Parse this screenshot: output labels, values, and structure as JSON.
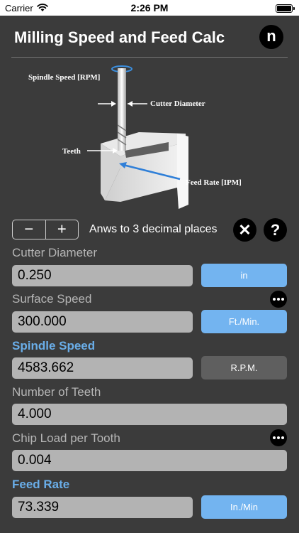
{
  "status_bar": {
    "carrier": "Carrier",
    "time": "2:26 PM",
    "wifi_icon": "wifi-icon",
    "battery_icon": "battery-icon"
  },
  "header": {
    "title": "Milling Speed and Feed Calc",
    "logo_letter": "n"
  },
  "diagram": {
    "spindle_label": "Spindle Speed [RPM]",
    "cutter_label": "Cutter Diameter",
    "teeth_label": "Teeth",
    "feed_label": "Feed Rate [IPM]"
  },
  "controls": {
    "decrement_label": "−",
    "increment_label": "+",
    "decimals_text": "Anws to 3 decimal places",
    "clear_symbol": "✕",
    "help_symbol": "?"
  },
  "fields": {
    "cutter_diameter": {
      "label": "Cutter Diameter",
      "value": "0.250",
      "unit": "in"
    },
    "surface_speed": {
      "label": "Surface Speed",
      "value": "300.000",
      "unit": "Ft./Min."
    },
    "spindle_speed": {
      "label": "Spindle Speed",
      "value": "4583.662",
      "unit": "R.P.M."
    },
    "number_of_teeth": {
      "label": "Number of Teeth",
      "value": "4.000"
    },
    "chip_load": {
      "label": "Chip Load per Tooth",
      "value": "0.004"
    },
    "feed_rate": {
      "label": "Feed Rate",
      "value": "73.339",
      "unit": "In./Min"
    }
  },
  "colors": {
    "background": "#3b3b3b",
    "accent_blue": "#73b4f0",
    "result_label_blue": "#6aaee9",
    "field_gray": "#b3b3b3"
  }
}
